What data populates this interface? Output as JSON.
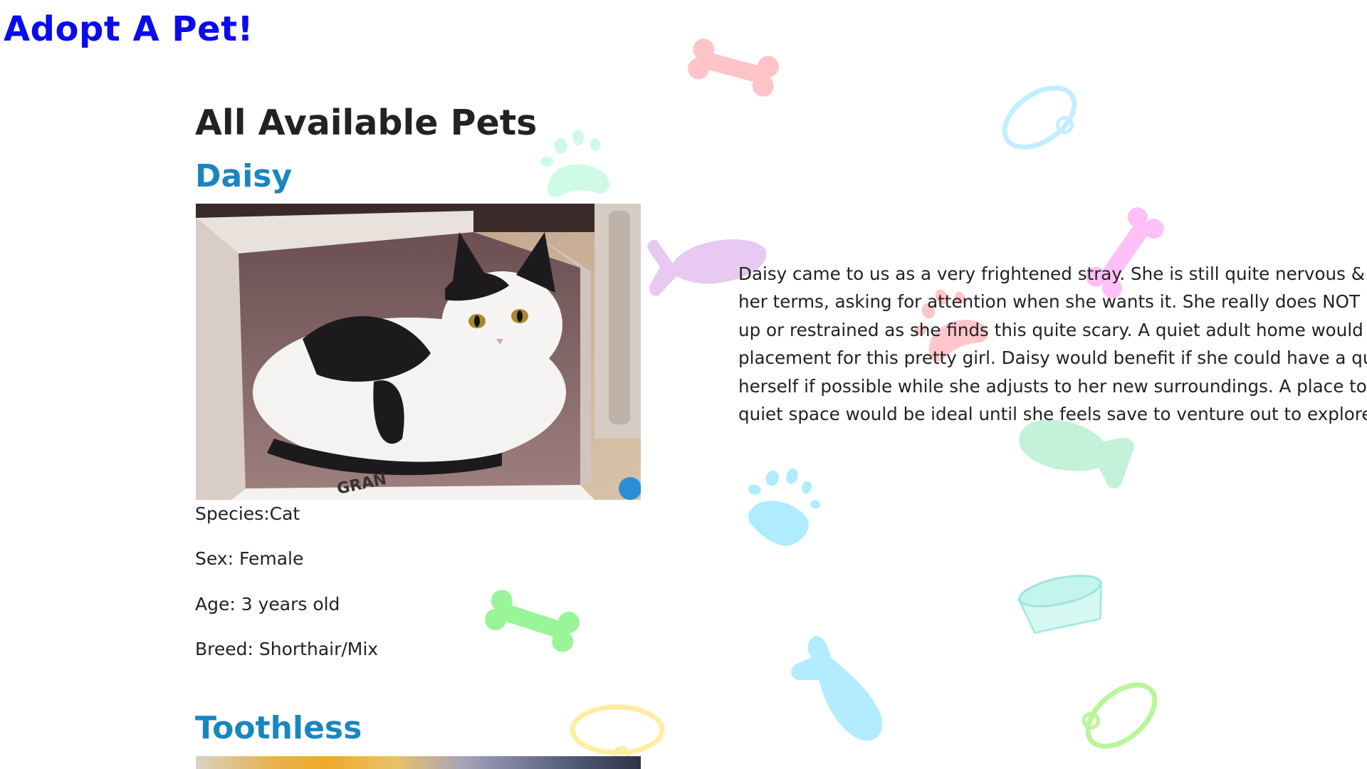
{
  "site": {
    "title": "Adopt A Pet!"
  },
  "page": {
    "heading": "All Available Pets"
  },
  "pets": [
    {
      "name": "Daisy",
      "photo": "black-and-white cat lying in a cardboard box",
      "species": "Species:Cat",
      "sex": "Sex: Female",
      "age": "Age: 3 years old",
      "breed": "Breed: Shorthair/Mix",
      "description_lines": [
        "Daisy came to us as a very frightened stray. She is still quite nervous & is affe",
        "her terms, asking for attention when she wants it. She really does NOT like to",
        "up or restrained as she finds this quite scary. A quiet adult home would be th",
        "placement for this pretty girl. Daisy would benefit if she could have a quiet ro",
        "herself if possible while she adjusts to her new surroundings. A place to hide",
        "quiet space would be ideal until she feels save to venture out to explore."
      ]
    },
    {
      "name": "Toothless"
    }
  ],
  "background_icons": [
    {
      "name": "bone-icon",
      "color": "#ffb3ba"
    },
    {
      "name": "collar-icon",
      "color": "#b3ecff"
    },
    {
      "name": "paw-print-icon",
      "color": "#c9fbe0"
    },
    {
      "name": "fish-icon",
      "color": "#e6c4f0"
    },
    {
      "name": "bone-icon",
      "color": "#ffb3f5"
    },
    {
      "name": "paw-print-icon",
      "color": "#ffb3ba"
    },
    {
      "name": "fish-icon",
      "color": "#baf0d4"
    },
    {
      "name": "paw-print-icon",
      "color": "#a8eaff"
    },
    {
      "name": "bowl-icon",
      "color": "#a8f0e4"
    },
    {
      "name": "bone-icon",
      "color": "#8ef58e"
    },
    {
      "name": "fish-icon",
      "color": "#a8ecff"
    },
    {
      "name": "collar-icon",
      "color": "#b9f593"
    },
    {
      "name": "collar-icon",
      "color": "#ffea99"
    }
  ]
}
